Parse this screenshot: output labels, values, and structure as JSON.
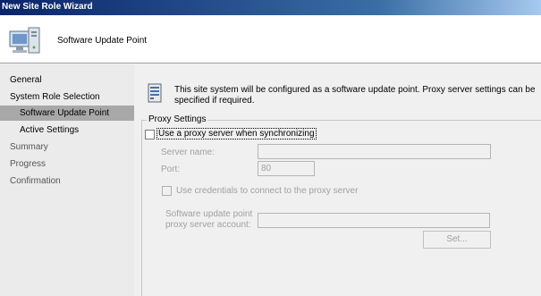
{
  "window": {
    "title": "New Site Role Wizard"
  },
  "header": {
    "title": "Software Update Point"
  },
  "nav": {
    "items": [
      {
        "label": "General"
      },
      {
        "label": "System Role Selection"
      },
      {
        "label": "Software Update Point",
        "selected": true
      },
      {
        "label": "Active Settings"
      },
      {
        "label": "Summary"
      },
      {
        "label": "Progress"
      },
      {
        "label": "Confirmation"
      }
    ]
  },
  "main": {
    "info_text": "This site system will be configured as a software update point. Proxy server settings can be specified if required.",
    "proxy_group": {
      "legend": "Proxy Settings",
      "use_proxy_label": "Use a proxy server when synchronizing",
      "use_proxy_checked": false,
      "server_name_label": "Server name:",
      "server_name_value": "",
      "port_label": "Port:",
      "port_value": "80",
      "use_credentials_label": "Use credentials to connect to the proxy server",
      "use_credentials_checked": false,
      "account_label_line1": "Software update point",
      "account_label_line2": "proxy server account:",
      "account_value": "",
      "set_button_label": "Set..."
    }
  },
  "icons": {
    "header": "computer-icon",
    "info": "server-icon"
  },
  "colors": {
    "title_bar": "#0a246a",
    "nav_selected": "#a8a8a8",
    "disabled_text": "#a0a0a0"
  }
}
